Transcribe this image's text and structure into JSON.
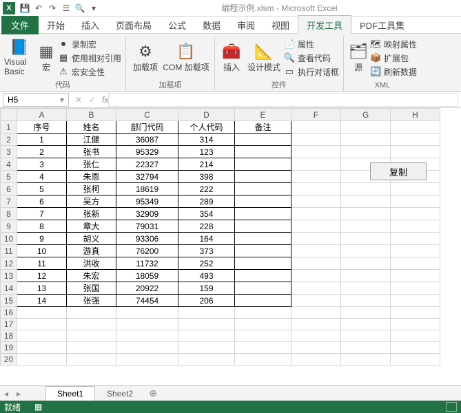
{
  "window": {
    "title": "编程示例.xlsm - Microsoft Excel"
  },
  "tabs": {
    "file": "文件",
    "l": [
      "开始",
      "插入",
      "页面布局",
      "公式",
      "数据",
      "审阅",
      "视图"
    ],
    "active": "开发工具",
    "after": [
      "PDF工具集"
    ]
  },
  "ribbon": {
    "g1": {
      "vb": "Visual Basic",
      "macro": "宏",
      "rec": "录制宏",
      "rel": "使用相对引用",
      "sec": "宏安全性",
      "label": "代码"
    },
    "g2": {
      "addin": "加载项",
      "com": "COM 加载项",
      "label": "加载项"
    },
    "g3": {
      "insert": "插入",
      "design": "设计模式",
      "prop": "属性",
      "view": "查看代码",
      "dlg": "执行对话框",
      "label": "控件"
    },
    "g4": {
      "src": "源",
      "map": "映射属性",
      "exp": "扩展包",
      "ref": "刷新数据",
      "label": "XML"
    }
  },
  "namebox": "H5",
  "headers": {
    "A": "序号",
    "B": "姓名",
    "C": "部门代码",
    "D": "个人代码",
    "E": "备注"
  },
  "copy_btn": "复制",
  "rows": [
    {
      "a": "1",
      "b": "江健",
      "c": "36087",
      "d": "314"
    },
    {
      "a": "2",
      "b": "张书",
      "c": "95329",
      "d": "123"
    },
    {
      "a": "3",
      "b": "张仁",
      "c": "22327",
      "d": "214"
    },
    {
      "a": "4",
      "b": "朱恩",
      "c": "32794",
      "d": "398"
    },
    {
      "a": "5",
      "b": "张柯",
      "c": "18619",
      "d": "222"
    },
    {
      "a": "6",
      "b": "吴方",
      "c": "95349",
      "d": "289"
    },
    {
      "a": "7",
      "b": "张新",
      "c": "32909",
      "d": "354"
    },
    {
      "a": "8",
      "b": "章大",
      "c": "79031",
      "d": "228"
    },
    {
      "a": "9",
      "b": "胡义",
      "c": "93306",
      "d": "164"
    },
    {
      "a": "10",
      "b": "游真",
      "c": "76200",
      "d": "373"
    },
    {
      "a": "11",
      "b": "洪收",
      "c": "11732",
      "d": "252"
    },
    {
      "a": "12",
      "b": "朱宏",
      "c": "18059",
      "d": "493"
    },
    {
      "a": "13",
      "b": "张国",
      "c": "20922",
      "d": "159"
    },
    {
      "a": "14",
      "b": "张强",
      "c": "74454",
      "d": "206"
    }
  ],
  "sheets": {
    "s1": "Sheet1",
    "s2": "Sheet2"
  },
  "status": "就绪"
}
